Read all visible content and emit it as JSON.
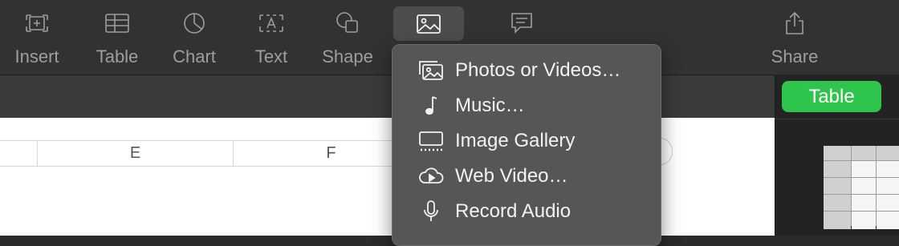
{
  "toolbar": {
    "items": [
      {
        "label": "Insert",
        "icon": "insert-icon"
      },
      {
        "label": "Table",
        "icon": "table-icon"
      },
      {
        "label": "Chart",
        "icon": "chart-icon"
      },
      {
        "label": "Text",
        "icon": "text-icon"
      },
      {
        "label": "Shape",
        "icon": "shape-icon"
      },
      {
        "label": "",
        "icon": "media-icon"
      },
      {
        "label": "",
        "icon": "comment-icon"
      },
      {
        "label": "Share",
        "icon": "share-icon"
      }
    ]
  },
  "sheet": {
    "columns": [
      "E",
      "F"
    ]
  },
  "sidebar": {
    "active_tab": "Table"
  },
  "media_menu": {
    "items": [
      {
        "label": "Photos or Videos…",
        "icon": "photos-icon"
      },
      {
        "label": "Music…",
        "icon": "music-note-icon"
      },
      {
        "label": "Image Gallery",
        "icon": "image-gallery-icon"
      },
      {
        "label": "Web Video…",
        "icon": "web-video-icon"
      },
      {
        "label": "Record Audio",
        "icon": "microphone-icon"
      }
    ]
  },
  "colors": {
    "toolbar_bg": "#323232",
    "menu_bg": "#565656",
    "accent_green": "#2fc54c"
  }
}
